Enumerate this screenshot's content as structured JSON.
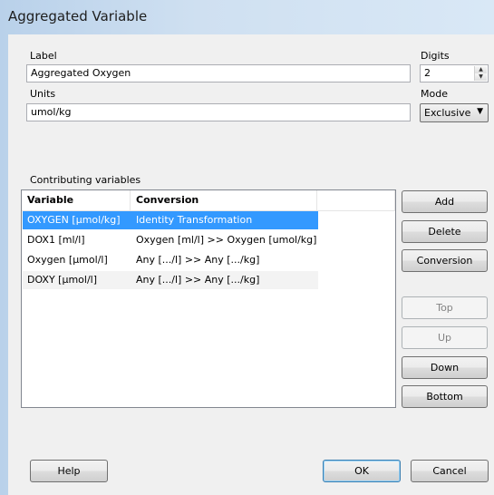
{
  "window": {
    "title": "Aggregated Variable"
  },
  "form": {
    "label_caption": "Label",
    "label_value": "Aggregated Oxygen",
    "digits_caption": "Digits",
    "digits_value": "2",
    "units_caption": "Units",
    "units_value": "umol/kg",
    "mode_caption": "Mode",
    "mode_value": "Exclusive"
  },
  "contributing": {
    "caption": "Contributing variables",
    "columns": [
      "Variable",
      "Conversion"
    ],
    "rows": [
      {
        "variable": "OXYGEN [µmol/kg]",
        "conversion": "Identity Transformation",
        "selected": true
      },
      {
        "variable": "DOX1 [ml/l]",
        "conversion": "Oxygen [ml/l] >> Oxygen [umol/kg]"
      },
      {
        "variable": "Oxygen [µmol/l]",
        "conversion": "Any [.../l] >> Any [.../kg]"
      },
      {
        "variable": "DOXY [µmol/l]",
        "conversion": "Any [.../l] >> Any [.../kg]"
      }
    ]
  },
  "buttons": {
    "add": "Add",
    "delete": "Delete",
    "conversion": "Conversion",
    "top": "Top",
    "up": "Up",
    "down": "Down",
    "bottom": "Bottom",
    "help": "Help",
    "ok": "OK",
    "cancel": "Cancel"
  }
}
